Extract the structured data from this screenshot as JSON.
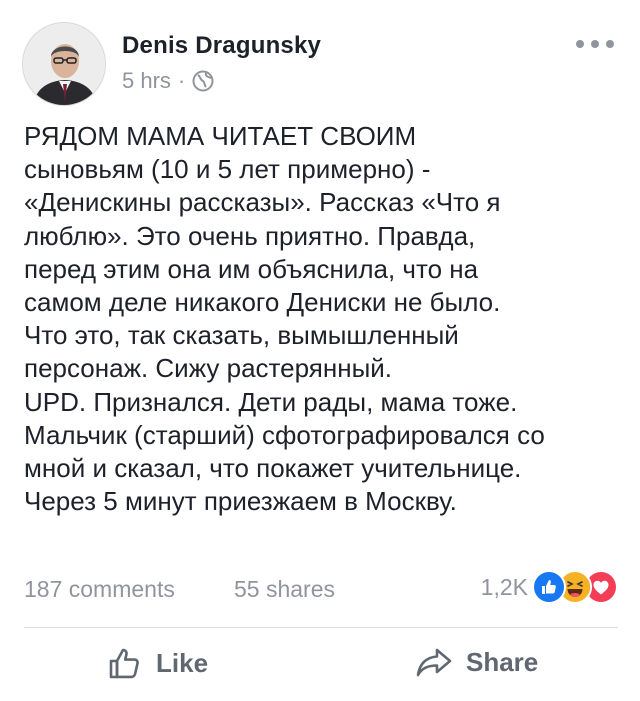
{
  "post": {
    "author": "Denis Dragunsky",
    "time": "5 hrs",
    "separator": "·",
    "privacy_icon": "globe-icon",
    "more_icon": "more-options-icon",
    "text": "РЯДОМ МАМА ЧИТАЕТ СВОИМ\nсыновьям (10 и 5 лет примерно) -\n«Денискины рассказы». Рассказ «Что я\nлюблю». Это очень приятно. Правда,\nперед этим она им объяснила, что на\nсамом деле никакого Дениски не было.\nЧто это, так сказать, вымышленный\nперсонаж. Сижу растерянный.\nUPD. Признался. Дети рады, мама тоже.\nМальчик (старший) сфотографировался со\nмной и сказал, что покажет учительнице.\nЧерез 5 минут приезжаем в Москву."
  },
  "stats": {
    "comments": "187 comments",
    "shares": "55 shares",
    "reactions_count": "1,2K",
    "reaction_icons": [
      "like-reaction-icon",
      "haha-reaction-icon",
      "love-reaction-icon"
    ]
  },
  "actions": {
    "like_label": "Like",
    "share_label": "Share"
  },
  "colors": {
    "text": "#1d2129",
    "secondary": "#90949c",
    "action": "#606770",
    "like_blue": "#1877f2",
    "haha_yellow": "#f7b125",
    "love_red": "#f33e58",
    "divider": "#dddfe2"
  }
}
